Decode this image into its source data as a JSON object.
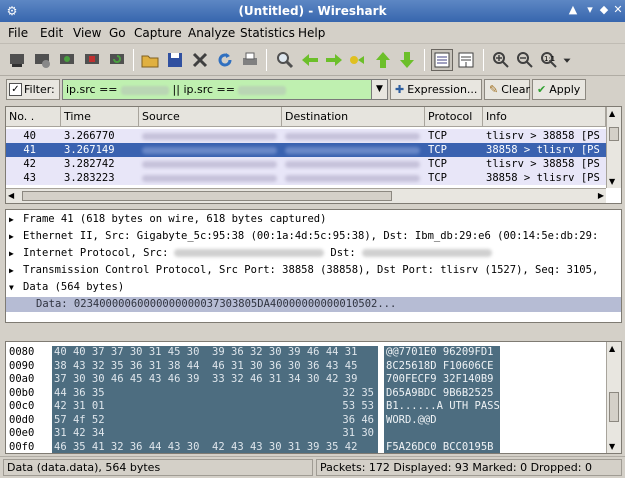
{
  "window": {
    "title": "(Untitled) - Wireshark"
  },
  "menu": [
    "File",
    "Edit",
    "View",
    "Go",
    "Capture",
    "Analyze",
    "Statistics",
    "Help"
  ],
  "filter": {
    "label": "Filter:",
    "prefix": "ip.src ==",
    "middle": "|| ip.src ==",
    "expression_label": "Expression...",
    "clear_label": "Clear",
    "apply_label": "Apply"
  },
  "packet_list": {
    "columns": [
      "No. .",
      "Time",
      "Source",
      "Destination",
      "Protocol",
      "Info"
    ],
    "rows": [
      {
        "no": "40",
        "time": "3.266770",
        "protocol": "TCP",
        "info": "tlisrv > 38858 [PS",
        "selected": false
      },
      {
        "no": "41",
        "time": "3.267149",
        "protocol": "TCP",
        "info": "38858 > tlisrv [PS",
        "selected": true
      },
      {
        "no": "42",
        "time": "3.282742",
        "protocol": "TCP",
        "info": "tlisrv > 38858 [PS",
        "selected": false
      },
      {
        "no": "43",
        "time": "3.283223",
        "protocol": "TCP",
        "info": "38858 > tlisrv [PS",
        "selected": false
      }
    ]
  },
  "details": [
    {
      "text": "Frame 41 (618 bytes on wire, 618 bytes captured)",
      "expanded": false
    },
    {
      "text": "Ethernet II, Src: Gigabyte_5c:95:38 (00:1a:4d:5c:95:38), Dst: Ibm_db:29:e6 (00:14:5e:db:29:",
      "expanded": false
    },
    {
      "text": "Internet Protocol, Src:",
      "dst": "Dst:",
      "expanded": false
    },
    {
      "text": "Transmission Control Protocol, Src Port: 38858 (38858), Dst Port: tlisrv (1527), Seq: 3105,",
      "expanded": false
    },
    {
      "text": "Data (564 bytes)",
      "expanded": true
    },
    {
      "text": "Data: 02340000060000000000037303805DA40000000000010502...",
      "child": true
    }
  ],
  "hex": [
    {
      "offset": "0080",
      "bytes": "40 40 37 37 30 31 45 30  39 36 32 30 39 46 44 31",
      "ascii": "@@7701E0 96209FD1"
    },
    {
      "offset": "0090",
      "bytes": "38 43 32 35 36 31 38 44  46 31 30 36 30 36 43 45",
      "ascii": "8C25618D F10606CE"
    },
    {
      "offset": "00a0",
      "bytes": "37 30 30 46 45 43 46 39  33 32 46 31 34 30 42 39",
      "ascii": "700FECF9 32F140B9"
    },
    {
      "offset": "00b0",
      "bytes": "44 36 35",
      "tail": "32 35",
      "ascii": "D65A9BDC 9B6B2525"
    },
    {
      "offset": "00c0",
      "bytes": "42 31 01",
      "tail": "53 53",
      "ascii": "B1......A UTH PASS"
    },
    {
      "offset": "00d0",
      "bytes": "57 4f 52",
      "tail": "36 46",
      "ascii": "WORD.@@D"
    },
    {
      "offset": "00e0",
      "bytes": "31 42 34",
      "tail": "31 30",
      "ascii": ""
    },
    {
      "offset": "00f0",
      "bytes": "46 35 41 32 36 44 43 30  42 43 43 30 31 39 35 42",
      "ascii": "F5A26DC0 BCC0195B"
    }
  ],
  "status": {
    "left": "Data (data.data), 564 bytes",
    "right": "Packets: 172 Displayed: 93 Marked: 0 Dropped: 0"
  },
  "colors": {
    "selected_row": "#3a62b0",
    "list_row_bg": "#e8e6f8",
    "filter_bg": "#bff0b0",
    "hex_highlight": "#4d6d80"
  }
}
